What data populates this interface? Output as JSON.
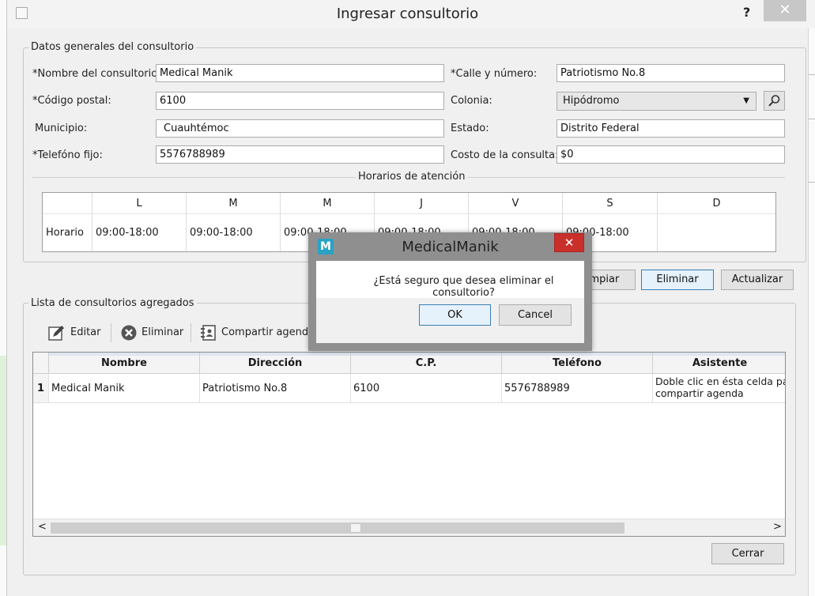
{
  "window": {
    "title": "Ingresar consultorio",
    "help_label": "?",
    "close_label": "✕"
  },
  "general": {
    "group_title": "Datos generales del consultorio",
    "fields": {
      "nombre": {
        "label": "*Nombre del consultorio:",
        "value": "Medical Manik"
      },
      "codigo_postal": {
        "label": "*Código postal:",
        "value": "6100"
      },
      "municipio": {
        "label": "Municipio:",
        "value": "Cuauhtémoc"
      },
      "telefono": {
        "label": "*Telefóno fijo:",
        "value": "5576788989"
      },
      "calle": {
        "label": "*Calle y número:",
        "value": "Patriotismo No.8"
      },
      "colonia": {
        "label": "Colonia:",
        "value": "Hipódromo"
      },
      "estado": {
        "label": "Estado:",
        "value": "Distrito Federal"
      },
      "costo": {
        "label": "Costo de la consulta:",
        "value": "$0"
      }
    },
    "horarios_title": "Horarios de atención",
    "schedule": {
      "days": [
        "L",
        "M",
        "M",
        "J",
        "V",
        "S",
        "D"
      ],
      "row_label": "Horario",
      "values": [
        "09:00-18:00",
        "09:00-18:00",
        "09:00-18:00",
        "09:00-18:00",
        "09:00-18:00",
        "09:00-18:00",
        ""
      ]
    }
  },
  "actions": {
    "limpiar": "Limpiar",
    "eliminar": "Eliminar",
    "actualizar": "Actualizar"
  },
  "list": {
    "group_title": "Lista de consultorios agregados",
    "toolbar": {
      "editar": "Editar",
      "eliminar": "Eliminar",
      "compartir": "Compartir agenda"
    },
    "columns": [
      "Nombre",
      "Dirección",
      "C.P.",
      "Teléfono",
      "Asistente"
    ],
    "rows": [
      {
        "num": "1",
        "nombre": "Medical Manik",
        "direccion": "Patriotismo No.8",
        "cp": "6100",
        "telefono": "5576788989",
        "asistente_1": "Doble clic en ésta celda par",
        "asistente_2": "compartir agenda"
      }
    ],
    "scroll_left": "<",
    "scroll_right": ">"
  },
  "footer": {
    "cerrar": "Cerrar"
  },
  "dialog": {
    "title": "MedicalManik",
    "icon_letter": "M",
    "close_label": "✕",
    "message": "¿Está seguro que desea eliminar el consultorio?",
    "ok": "OK",
    "cancel": "Cancel"
  },
  "colors": {
    "dialog_close": "#c9302c",
    "app_icon": "#2aa2c4",
    "focus_border": "#3c7fb1"
  }
}
